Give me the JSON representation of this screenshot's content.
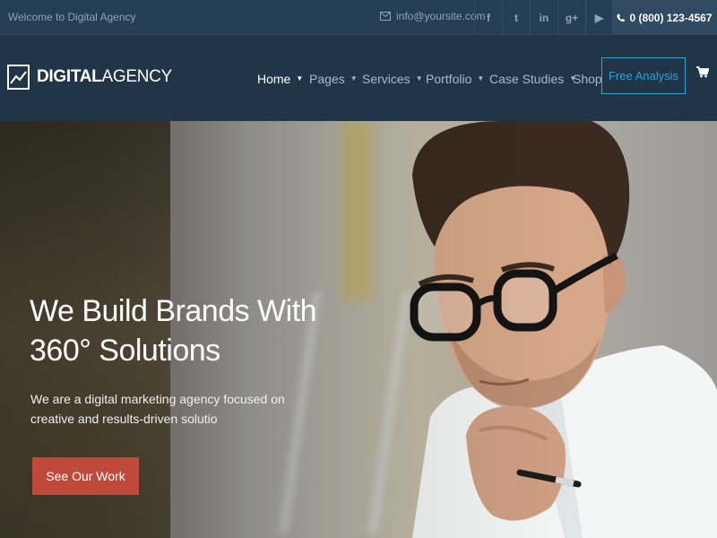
{
  "topbar": {
    "welcome": "Welcome to Digital Agency",
    "email": "info@yoursite.com",
    "social": [
      {
        "name": "facebook-icon",
        "glyph": "f"
      },
      {
        "name": "twitter-icon",
        "glyph": "t"
      },
      {
        "name": "linkedin-icon",
        "glyph": "in"
      },
      {
        "name": "google-plus-icon",
        "glyph": "g+"
      },
      {
        "name": "youtube-icon",
        "glyph": "▶"
      }
    ],
    "phone": "0 (800) 123-4567"
  },
  "header": {
    "logo_bold": "DIGITAL",
    "logo_light": "AGENCY",
    "nav": [
      {
        "label": "Home",
        "caret": true,
        "active": true
      },
      {
        "label": "Pages",
        "caret": true
      },
      {
        "label": "Services",
        "caret": true
      },
      {
        "label": "Portfolio",
        "caret": true
      },
      {
        "label": "Case Studies",
        "caret": true
      },
      {
        "label": "Shop",
        "caret": false
      }
    ],
    "cta": "Free Analysis",
    "cart_icon": "cart-icon"
  },
  "hero": {
    "title_line1": "We Build Brands With",
    "title_line2": "360° Solutions",
    "subtitle_line1": "We are a digital marketing agency focused on",
    "subtitle_line2": "creative and results-driven solutio",
    "button": "See Our Work"
  },
  "colors": {
    "topbar": "#263e54",
    "header": "#203547",
    "accent": "#29a5d6",
    "button": "#c04a3a"
  }
}
